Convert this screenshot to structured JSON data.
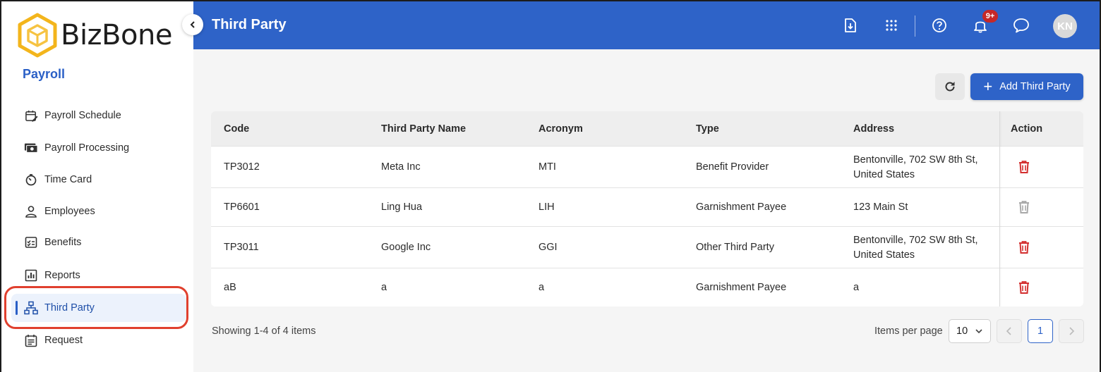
{
  "app": {
    "logo_text": "BizBone",
    "module_title": "Payroll"
  },
  "sidebar": {
    "items": [
      {
        "label": "Payroll Schedule",
        "icon": "calendar-edit-icon",
        "active": false
      },
      {
        "label": "Payroll Processing",
        "icon": "money-icon",
        "active": false
      },
      {
        "label": "Time Card",
        "icon": "timer-icon",
        "active": false
      },
      {
        "label": "Employees",
        "icon": "person-icon",
        "active": false
      },
      {
        "label": "Benefits",
        "icon": "checklist-icon",
        "active": false
      },
      {
        "label": "Reports",
        "icon": "bar-chart-icon",
        "active": false
      },
      {
        "label": "Third Party",
        "icon": "org-chart-icon",
        "active": true
      },
      {
        "label": "Request",
        "icon": "calendar-list-icon",
        "active": false
      }
    ]
  },
  "header": {
    "title": "Third Party",
    "notification_badge": "9+",
    "avatar_initials": "KN"
  },
  "toolbar": {
    "add_label": "Add Third Party"
  },
  "table": {
    "columns": [
      "Code",
      "Third Party Name",
      "Acronym",
      "Type",
      "Address",
      "Action"
    ],
    "rows": [
      {
        "code": "TP3012",
        "name": "Meta Inc",
        "acronym": "MTI",
        "type": "Benefit Provider",
        "address_line1": "Bentonville, 702 SW 8th St,",
        "address_line2": "United States",
        "delete_enabled": true
      },
      {
        "code": "TP6601",
        "name": "Ling Hua",
        "acronym": "LIH",
        "type": "Garnishment Payee",
        "address_line1": "123 Main St",
        "address_line2": "",
        "delete_enabled": false
      },
      {
        "code": "TP3011",
        "name": "Google Inc",
        "acronym": "GGI",
        "type": "Other Third Party",
        "address_line1": "Bentonville, 702 SW 8th St,",
        "address_line2": "United States",
        "delete_enabled": true
      },
      {
        "code": "aB",
        "name": "a",
        "acronym": "a",
        "type": "Garnishment Payee",
        "address_line1": "a",
        "address_line2": "",
        "delete_enabled": true
      }
    ]
  },
  "footer": {
    "showing": "Showing 1-4 of 4 items",
    "items_per_page_label": "Items per page",
    "items_per_page": "10",
    "current_page": "1"
  },
  "colors": {
    "brand": "#2e63c8",
    "delete_active": "#d32f2f",
    "delete_disabled": "#a8a8a8",
    "highlight": "#e0402e"
  }
}
